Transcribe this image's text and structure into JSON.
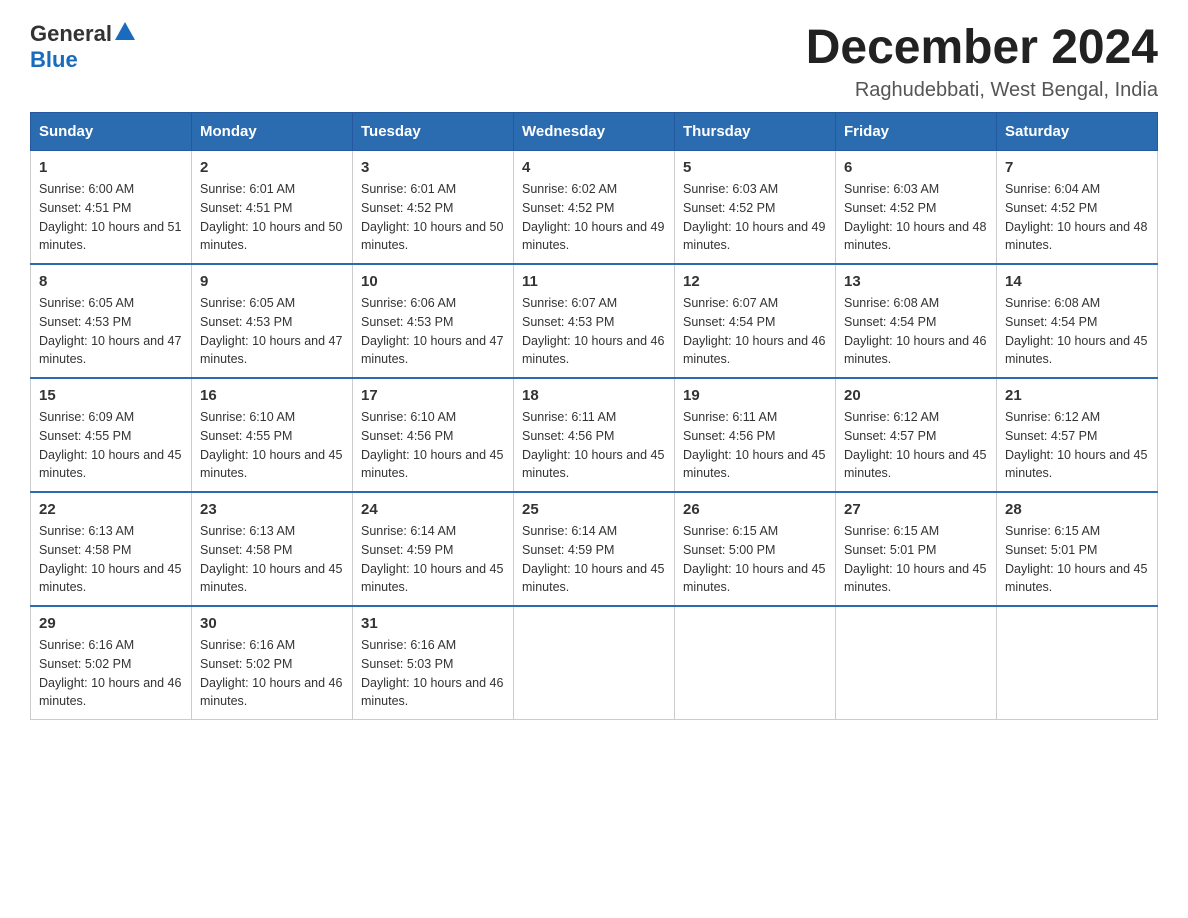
{
  "logo": {
    "general": "General",
    "blue": "Blue"
  },
  "header": {
    "month": "December 2024",
    "location": "Raghudebbati, West Bengal, India"
  },
  "weekdays": [
    "Sunday",
    "Monday",
    "Tuesday",
    "Wednesday",
    "Thursday",
    "Friday",
    "Saturday"
  ],
  "weeks": [
    [
      {
        "day": "1",
        "sunrise": "6:00 AM",
        "sunset": "4:51 PM",
        "daylight": "10 hours and 51 minutes."
      },
      {
        "day": "2",
        "sunrise": "6:01 AM",
        "sunset": "4:51 PM",
        "daylight": "10 hours and 50 minutes."
      },
      {
        "day": "3",
        "sunrise": "6:01 AM",
        "sunset": "4:52 PM",
        "daylight": "10 hours and 50 minutes."
      },
      {
        "day": "4",
        "sunrise": "6:02 AM",
        "sunset": "4:52 PM",
        "daylight": "10 hours and 49 minutes."
      },
      {
        "day": "5",
        "sunrise": "6:03 AM",
        "sunset": "4:52 PM",
        "daylight": "10 hours and 49 minutes."
      },
      {
        "day": "6",
        "sunrise": "6:03 AM",
        "sunset": "4:52 PM",
        "daylight": "10 hours and 48 minutes."
      },
      {
        "day": "7",
        "sunrise": "6:04 AM",
        "sunset": "4:52 PM",
        "daylight": "10 hours and 48 minutes."
      }
    ],
    [
      {
        "day": "8",
        "sunrise": "6:05 AM",
        "sunset": "4:53 PM",
        "daylight": "10 hours and 47 minutes."
      },
      {
        "day": "9",
        "sunrise": "6:05 AM",
        "sunset": "4:53 PM",
        "daylight": "10 hours and 47 minutes."
      },
      {
        "day": "10",
        "sunrise": "6:06 AM",
        "sunset": "4:53 PM",
        "daylight": "10 hours and 47 minutes."
      },
      {
        "day": "11",
        "sunrise": "6:07 AM",
        "sunset": "4:53 PM",
        "daylight": "10 hours and 46 minutes."
      },
      {
        "day": "12",
        "sunrise": "6:07 AM",
        "sunset": "4:54 PM",
        "daylight": "10 hours and 46 minutes."
      },
      {
        "day": "13",
        "sunrise": "6:08 AM",
        "sunset": "4:54 PM",
        "daylight": "10 hours and 46 minutes."
      },
      {
        "day": "14",
        "sunrise": "6:08 AM",
        "sunset": "4:54 PM",
        "daylight": "10 hours and 45 minutes."
      }
    ],
    [
      {
        "day": "15",
        "sunrise": "6:09 AM",
        "sunset": "4:55 PM",
        "daylight": "10 hours and 45 minutes."
      },
      {
        "day": "16",
        "sunrise": "6:10 AM",
        "sunset": "4:55 PM",
        "daylight": "10 hours and 45 minutes."
      },
      {
        "day": "17",
        "sunrise": "6:10 AM",
        "sunset": "4:56 PM",
        "daylight": "10 hours and 45 minutes."
      },
      {
        "day": "18",
        "sunrise": "6:11 AM",
        "sunset": "4:56 PM",
        "daylight": "10 hours and 45 minutes."
      },
      {
        "day": "19",
        "sunrise": "6:11 AM",
        "sunset": "4:56 PM",
        "daylight": "10 hours and 45 minutes."
      },
      {
        "day": "20",
        "sunrise": "6:12 AM",
        "sunset": "4:57 PM",
        "daylight": "10 hours and 45 minutes."
      },
      {
        "day": "21",
        "sunrise": "6:12 AM",
        "sunset": "4:57 PM",
        "daylight": "10 hours and 45 minutes."
      }
    ],
    [
      {
        "day": "22",
        "sunrise": "6:13 AM",
        "sunset": "4:58 PM",
        "daylight": "10 hours and 45 minutes."
      },
      {
        "day": "23",
        "sunrise": "6:13 AM",
        "sunset": "4:58 PM",
        "daylight": "10 hours and 45 minutes."
      },
      {
        "day": "24",
        "sunrise": "6:14 AM",
        "sunset": "4:59 PM",
        "daylight": "10 hours and 45 minutes."
      },
      {
        "day": "25",
        "sunrise": "6:14 AM",
        "sunset": "4:59 PM",
        "daylight": "10 hours and 45 minutes."
      },
      {
        "day": "26",
        "sunrise": "6:15 AM",
        "sunset": "5:00 PM",
        "daylight": "10 hours and 45 minutes."
      },
      {
        "day": "27",
        "sunrise": "6:15 AM",
        "sunset": "5:01 PM",
        "daylight": "10 hours and 45 minutes."
      },
      {
        "day": "28",
        "sunrise": "6:15 AM",
        "sunset": "5:01 PM",
        "daylight": "10 hours and 45 minutes."
      }
    ],
    [
      {
        "day": "29",
        "sunrise": "6:16 AM",
        "sunset": "5:02 PM",
        "daylight": "10 hours and 46 minutes."
      },
      {
        "day": "30",
        "sunrise": "6:16 AM",
        "sunset": "5:02 PM",
        "daylight": "10 hours and 46 minutes."
      },
      {
        "day": "31",
        "sunrise": "6:16 AM",
        "sunset": "5:03 PM",
        "daylight": "10 hours and 46 minutes."
      },
      null,
      null,
      null,
      null
    ]
  ],
  "labels": {
    "sunrise": "Sunrise:",
    "sunset": "Sunset:",
    "daylight": "Daylight:"
  }
}
